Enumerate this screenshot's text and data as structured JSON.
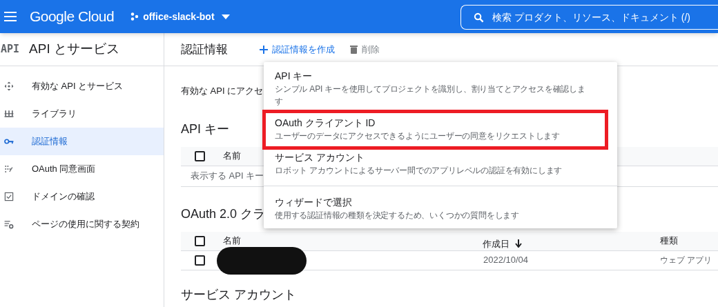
{
  "header": {
    "brand": "Google Cloud",
    "project": "office-slack-bot",
    "search_placeholder": "検索  プロダクト、リソース、ドキュメント (/)"
  },
  "sidebar": {
    "badge": "API",
    "title": "API とサービス",
    "items": [
      {
        "label": "有効な API とサービス",
        "selected": false
      },
      {
        "label": "ライブラリ",
        "selected": false
      },
      {
        "label": "認証情報",
        "selected": true
      },
      {
        "label": "OAuth 同意画面",
        "selected": false
      },
      {
        "label": "ドメインの確認",
        "selected": false
      },
      {
        "label": "ページの使用に関する契約",
        "selected": false
      }
    ]
  },
  "page": {
    "title": "認証情報",
    "actions": [
      {
        "label": "認証情報を作成",
        "kind": "create"
      },
      {
        "label": "削除",
        "kind": "delete"
      }
    ],
    "intro": "有効な API にアクセ",
    "api_keys": {
      "heading": "API キー",
      "select_all": {
        "checked": false
      },
      "columns": [
        "名前"
      ],
      "empty": "表示する API キー"
    },
    "oauth": {
      "heading": "OAuth 2.0 クラ",
      "select_all": {
        "checked": false
      },
      "columns": [
        "名前",
        "作成日",
        "種類"
      ],
      "rows": [
        {
          "checked": false,
          "created": "2022/10/04",
          "type": "ウェブ アプリ"
        }
      ]
    },
    "service_accounts": {
      "heading": "サービス アカウント"
    }
  },
  "menu": {
    "items": [
      {
        "title": "API キー",
        "description": "シンプル API キーを使用してプロジェクトを識別し、割り当てとアクセスを確認します",
        "highlighted": false,
        "divider_before": false
      },
      {
        "title": "OAuth クライアント ID",
        "description": "ユーザーのデータにアクセスできるようにユーザーの同意をリクエストします",
        "highlighted": true,
        "divider_before": false
      },
      {
        "title": "サービス アカウント",
        "description": "ロボット アカウントによるサーバー間でのアプリレベルの認証を有効にします",
        "highlighted": false,
        "divider_before": false
      },
      {
        "title": "ウィザードで選択",
        "description": "使用する認証情報の種類を決定するため、いくつかの質問をします",
        "highlighted": false,
        "divider_before": true
      }
    ]
  }
}
